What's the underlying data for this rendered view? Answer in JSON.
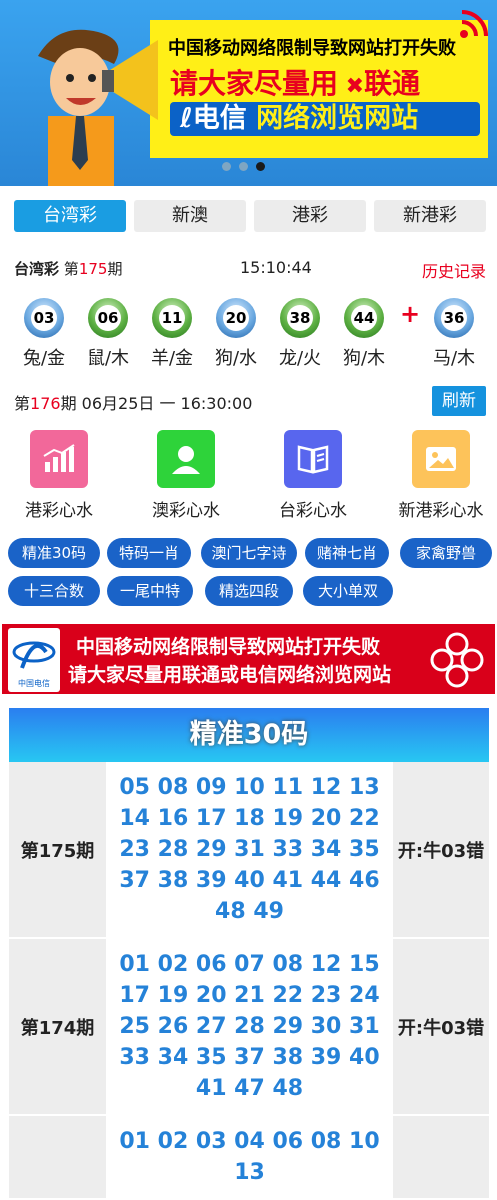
{
  "banner": {
    "line1": "中国移动网络限制导致网站打开失败",
    "line2": "请大家尽量用",
    "line2b": "联通",
    "line3a": "电信",
    "line3b": "网络浏览网站"
  },
  "tabs": [
    {
      "label": "台湾彩",
      "active": true
    },
    {
      "label": "新澳",
      "active": false
    },
    {
      "label": "港彩",
      "active": false
    },
    {
      "label": "新港彩",
      "active": false
    }
  ],
  "draw": {
    "name": "台湾彩",
    "pre": "第",
    "period": "175",
    "post": "期",
    "time": "15:10:44",
    "history": "历史记录"
  },
  "balls": [
    {
      "num": "03",
      "color": "blue",
      "label": "兔/金"
    },
    {
      "num": "06",
      "color": "green",
      "label": "鼠/木"
    },
    {
      "num": "11",
      "color": "green",
      "label": "羊/金"
    },
    {
      "num": "20",
      "color": "blue",
      "label": "狗/水"
    },
    {
      "num": "38",
      "color": "green",
      "label": "龙/火"
    },
    {
      "num": "44",
      "color": "green",
      "label": "狗/木"
    },
    {
      "num": "36",
      "color": "blue",
      "label": "马/木"
    }
  ],
  "plus": "+",
  "next": {
    "pre": "第",
    "period": "176",
    "rest": "期 06月25日 一 16:30:00"
  },
  "refresh": "刷新",
  "apps": [
    {
      "label": "港彩心水",
      "icon": "chart-icon",
      "color": "#f2689a"
    },
    {
      "label": "澳彩心水",
      "icon": "user-icon",
      "color": "#2ed33a"
    },
    {
      "label": "台彩心水",
      "icon": "book-icon",
      "color": "#5866ee"
    },
    {
      "label": "新港彩心水",
      "icon": "image-icon",
      "color": "#fdc35a"
    }
  ],
  "chips": [
    "精准30码",
    "特码一肖",
    "澳门七字诗",
    "赌神七肖",
    "家禽野兽",
    "十三合数",
    "一尾中特",
    "精选四段",
    "大小单双"
  ],
  "notice": {
    "line1": "中国移动网络限制导致网站打开失败",
    "line2": "请大家尽量用联通或电信网络浏览网站",
    "logo_text": "中国电信"
  },
  "precise": {
    "title": "精准30码",
    "rows": [
      {
        "period": "第175期",
        "nums": "05 08 09 10 11 12 13 14 16 17 18 19 20 22 23 28 29 31 33 34 35 37 38 39 40 41 44 46 48 49",
        "result": "开:牛03错"
      },
      {
        "period": "第174期",
        "nums": "01 02 06 07 08 12 15 17 19 20 21 22 23 24 25 26 27 28 29 30 31 33 34 35 37 38 39 40 41 47 48",
        "result": "开:牛03错"
      },
      {
        "period": "",
        "nums": "01 02 03 04 06 08 10 13",
        "result": ""
      }
    ]
  }
}
